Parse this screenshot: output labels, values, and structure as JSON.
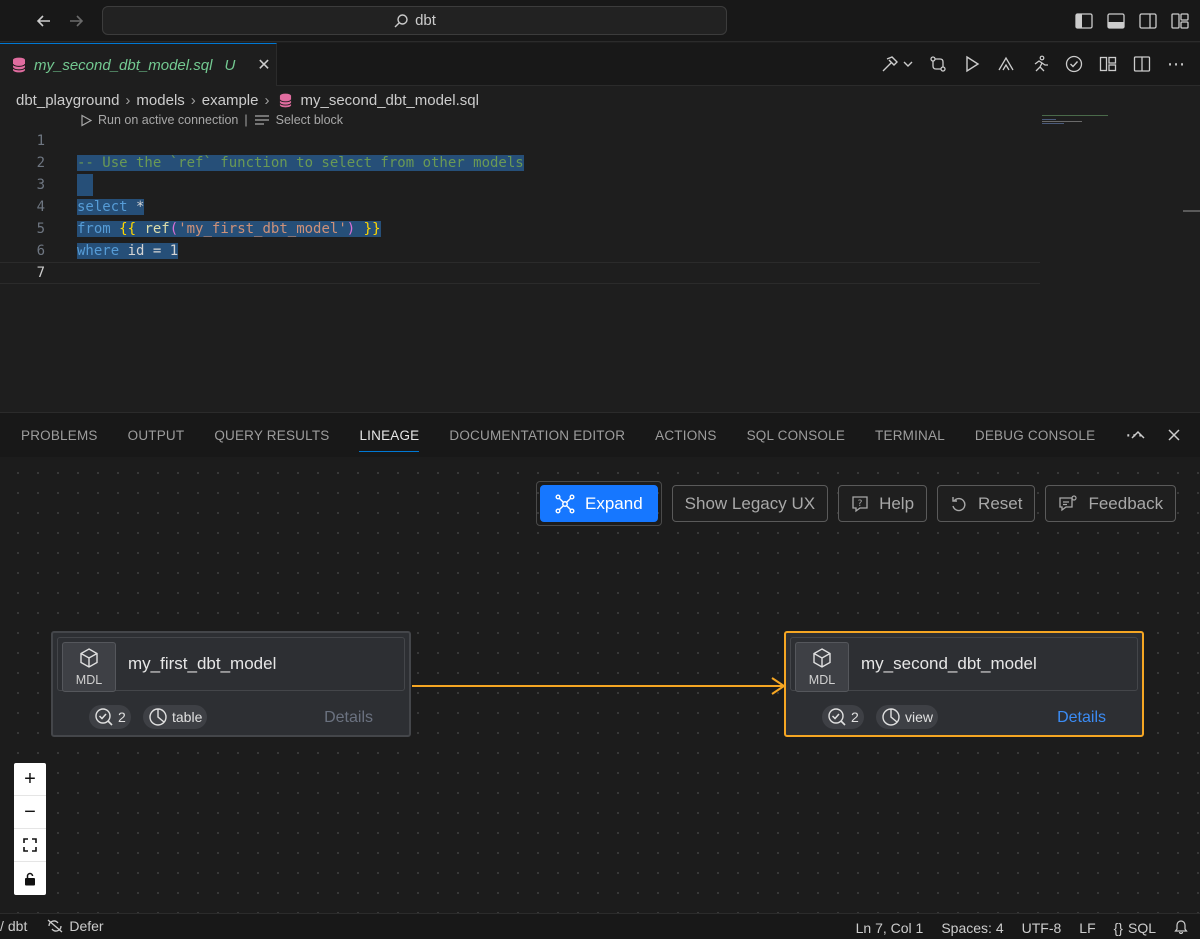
{
  "titlebar": {
    "search_text": "dbt"
  },
  "tab": {
    "filename": "my_second_dbt_model.sql",
    "status": "U"
  },
  "breadcrumb": [
    "dbt_playground",
    "models",
    "example",
    "my_second_dbt_model.sql"
  ],
  "codelens": {
    "run": "Run on active connection",
    "sep": "|",
    "select": "Select block"
  },
  "editor": {
    "line_numbers": [
      "1",
      "2",
      "3",
      "4",
      "5",
      "6",
      "7"
    ],
    "active_line": "7",
    "lines": {
      "l2": "-- Use the `ref` function to select from other models",
      "l4_kw": "select",
      "l4_rest": " *",
      "l5_kw": "from",
      "l5_open": "{{",
      "l5_fn": "ref",
      "l5_paren_open": "(",
      "l5_str": "'my_first_dbt_model'",
      "l5_paren_close": ")",
      "l5_close": "}}",
      "l6_kw": "where",
      "l6_rest": " id = 1"
    }
  },
  "panel": {
    "tabs": [
      "PROBLEMS",
      "OUTPUT",
      "QUERY RESULTS",
      "LINEAGE",
      "DOCUMENTATION EDITOR",
      "ACTIONS",
      "SQL CONSOLE",
      "TERMINAL",
      "DEBUG CONSOLE"
    ],
    "active_tab": "LINEAGE"
  },
  "lineage": {
    "buttons": {
      "expand": "Expand",
      "legacy": "Show Legacy UX",
      "help": "Help",
      "reset": "Reset",
      "feedback": "Feedback"
    },
    "nodes": [
      {
        "type_label": "MDL",
        "name": "my_first_dbt_model",
        "tests": "2",
        "materialization": "table",
        "details": "Details",
        "selected": false
      },
      {
        "type_label": "MDL",
        "name": "my_second_dbt_model",
        "tests": "2",
        "materialization": "view",
        "details": "Details",
        "selected": true
      }
    ],
    "colors": {
      "selected_border": "#f5a623",
      "edge": "#f5a623",
      "primary_button": "#1677ff"
    }
  },
  "statusbar": {
    "project": "dbt",
    "defer": "Defer",
    "position": "Ln 7, Col 1",
    "spaces": "Spaces: 4",
    "encoding": "UTF-8",
    "eol": "LF",
    "language": "SQL"
  }
}
